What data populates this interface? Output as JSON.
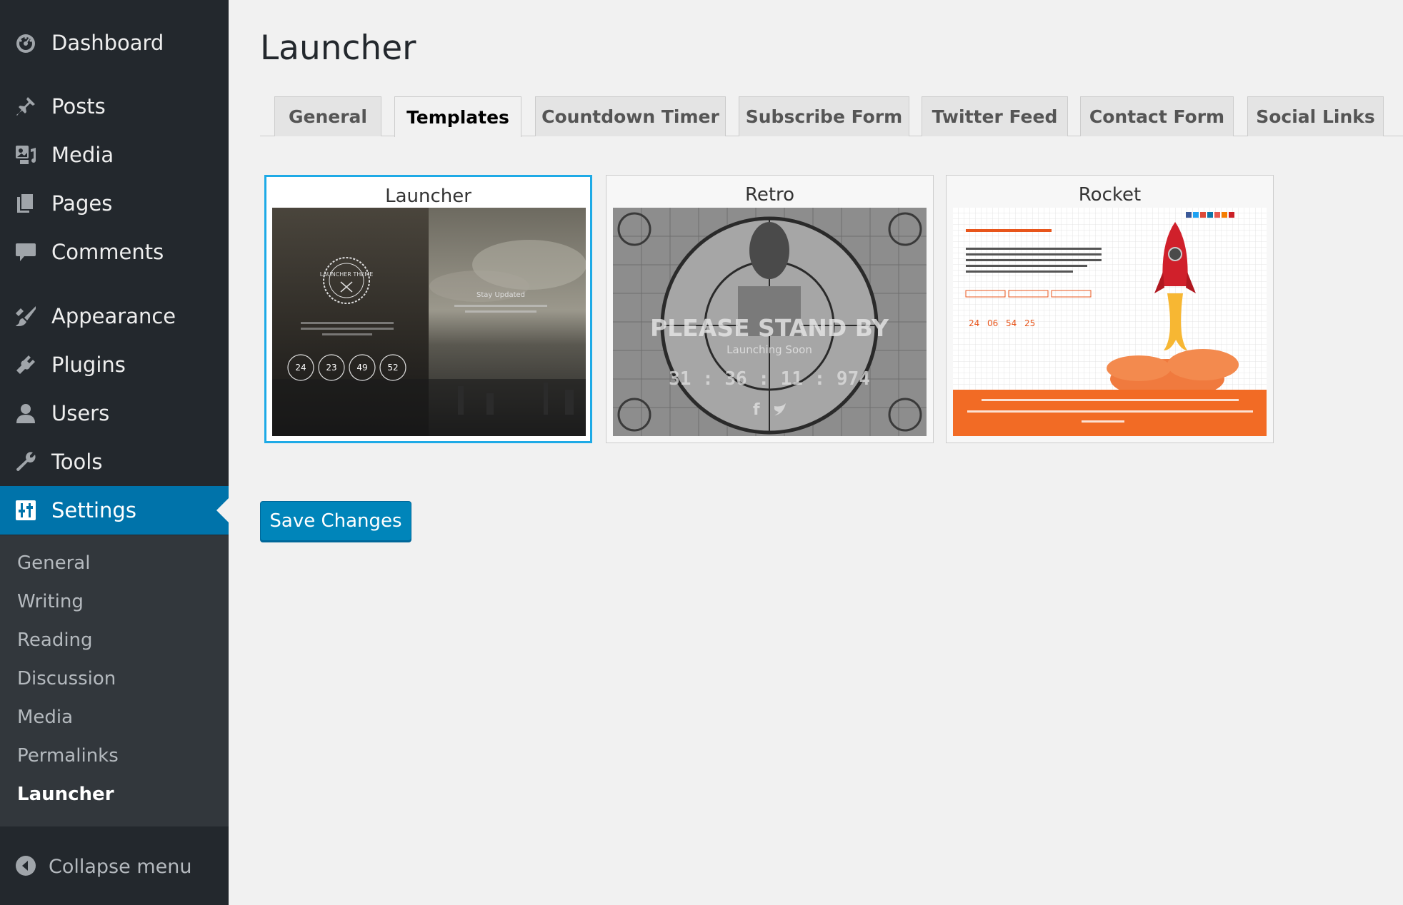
{
  "sidebar": {
    "items": [
      {
        "label": "Dashboard",
        "icon": "dashboard-icon"
      },
      {
        "label": "Posts",
        "icon": "pushpin-icon"
      },
      {
        "label": "Media",
        "icon": "media-icon"
      },
      {
        "label": "Pages",
        "icon": "pages-icon"
      },
      {
        "label": "Comments",
        "icon": "comment-icon"
      },
      {
        "label": "Appearance",
        "icon": "paintbrush-icon"
      },
      {
        "label": "Plugins",
        "icon": "plugin-icon"
      },
      {
        "label": "Users",
        "icon": "user-icon"
      },
      {
        "label": "Tools",
        "icon": "wrench-icon"
      },
      {
        "label": "Settings",
        "icon": "settings-icon",
        "active": true
      }
    ],
    "submenu": [
      "General",
      "Writing",
      "Reading",
      "Discussion",
      "Media",
      "Permalinks",
      "Launcher"
    ],
    "current_submenu": "Launcher",
    "collapse_label": "Collapse menu"
  },
  "page": {
    "title": "Launcher"
  },
  "tabs": [
    {
      "label": "General"
    },
    {
      "label": "Templates",
      "active": true
    },
    {
      "label": "Countdown Timer"
    },
    {
      "label": "Subscribe Form"
    },
    {
      "label": "Twitter Feed"
    },
    {
      "label": "Contact Form"
    },
    {
      "label": "Social Links"
    }
  ],
  "templates": [
    {
      "name": "Launcher",
      "selected": true,
      "thumb": {
        "badge": "LAUNCHER THEME",
        "heading": "Stay Updated",
        "countdown": [
          "24",
          "23",
          "49",
          "52"
        ]
      }
    },
    {
      "name": "Retro",
      "selected": false,
      "thumb": {
        "headline": "PLEASE STAND BY",
        "subline": "Launching Soon",
        "countdown": "31 : 36 : 11 : 974"
      }
    },
    {
      "name": "Rocket",
      "selected": false,
      "thumb": {
        "countdown": [
          "24",
          "06",
          "54",
          "25"
        ]
      }
    }
  ],
  "save_label": "Save Changes",
  "colors": {
    "sidebar_bg": "#23282d",
    "submenu_bg": "#32373c",
    "accent": "#0073aa",
    "button": "#0085ba",
    "selected_border": "#1eaae6"
  }
}
